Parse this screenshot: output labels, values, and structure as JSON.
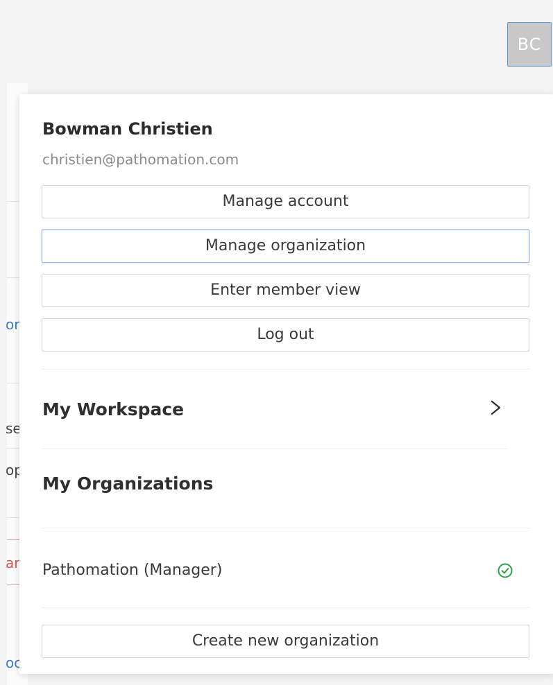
{
  "header": {
    "avatar_initials": "BC"
  },
  "background_fragments": [
    "or",
    "se",
    "op",
    "ar",
    "oc"
  ],
  "account_menu": {
    "user_name": "Bowman Christien",
    "user_email": "christien@pathomation.com",
    "buttons": {
      "manage_account": "Manage account",
      "manage_organization": "Manage organization",
      "enter_member_view": "Enter member view",
      "log_out": "Log out"
    },
    "workspace": {
      "label": "My Workspace",
      "icon": "chevron-right-icon"
    },
    "organizations": {
      "heading": "My Organizations",
      "items": [
        {
          "name": "Pathomation (Manager)",
          "active": true,
          "icon": "check-circle-icon"
        }
      ],
      "create_label": "Create new organization"
    }
  },
  "colors": {
    "accent_focus": "#8fb8e3",
    "active_check": "#2e9e4a",
    "link_blue": "#3a7bc8",
    "danger_red": "#d9534f",
    "avatar_bg": "#c8c8c8"
  }
}
